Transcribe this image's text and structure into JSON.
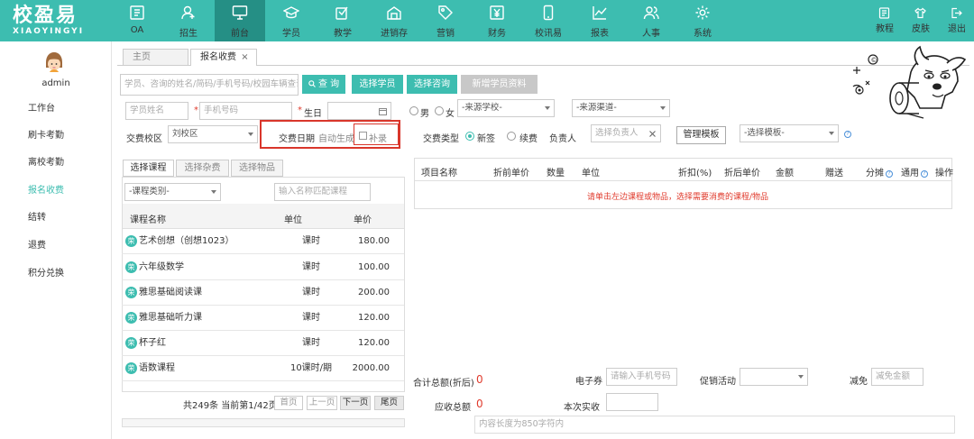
{
  "app": {
    "logo_cn": "校盈易",
    "logo_en": "XIAOYINGYI"
  },
  "nav": {
    "items": [
      {
        "label": "OA",
        "icon": "oa-icon"
      },
      {
        "label": "招生",
        "icon": "person-plus-icon"
      },
      {
        "label": "前台",
        "icon": "monitor-icon"
      },
      {
        "label": "学员",
        "icon": "graduation-cap-icon"
      },
      {
        "label": "教学",
        "icon": "book-pen-icon"
      },
      {
        "label": "进销存",
        "icon": "warehouse-icon"
      },
      {
        "label": "营销",
        "icon": "tag-icon"
      },
      {
        "label": "财务",
        "icon": "yen-icon"
      },
      {
        "label": "校讯易",
        "icon": "phone-icon"
      },
      {
        "label": "报表",
        "icon": "chart-icon"
      },
      {
        "label": "人事",
        "icon": "people-icon"
      },
      {
        "label": "系统",
        "icon": "gear-icon"
      }
    ],
    "active": "前台",
    "right": [
      {
        "label": "教程",
        "icon": "tutorial-icon"
      },
      {
        "label": "皮肤",
        "icon": "shirt-icon"
      },
      {
        "label": "退出",
        "icon": "exit-icon"
      }
    ]
  },
  "sidebar": {
    "user": "admin",
    "items": [
      {
        "label": "工作台"
      },
      {
        "label": "刷卡考勤"
      },
      {
        "label": "离校考勤"
      },
      {
        "label": "报名收费"
      },
      {
        "label": "结转"
      },
      {
        "label": "退费"
      },
      {
        "label": "积分兑换"
      }
    ],
    "active": "报名收费"
  },
  "tabs": [
    {
      "label": "主页"
    },
    {
      "label": "报名收费",
      "close": "×"
    }
  ],
  "search": {
    "placeholder": "学员、咨询的姓名/简码/手机号码/校园车辆查询",
    "search_btn": "查 询",
    "select_student": "选择学员",
    "select_consult": "选择咨询",
    "new_student": "新增学员资料"
  },
  "form": {
    "name_placeholder": "学员姓名",
    "phone_placeholder": "手机号码",
    "birthday_label": "生日",
    "gender_male": "男",
    "gender_female": "女",
    "school_select": "-来源学校-",
    "channel_select": "-来源渠道-",
    "campus_label": "交费校区",
    "campus_value": "刘校区",
    "pay_date_label": "交费日期",
    "auto_gen": "自动生成",
    "makeup": "补录",
    "pay_type_label": "交费类型",
    "pay_type_new": "新签",
    "pay_type_renew": "续费",
    "person_label": "负责人",
    "person_placeholder": "选择负责人",
    "manage_template": "管理模板",
    "template_select": "-选择模板-",
    "required_mark": "*"
  },
  "left_panel": {
    "tabs": [
      "选择课程",
      "选择杂费",
      "选择物品"
    ],
    "category_select": "-课程类别-",
    "name_filter_placeholder": "输入名称匹配课程",
    "headers": {
      "name": "课程名称",
      "unit": "单位",
      "price": "单价"
    },
    "course_icon": "荣",
    "courses": [
      {
        "name": "艺术创想（创想1023）",
        "unit": "课时",
        "price": "180.00"
      },
      {
        "name": "六年级数学",
        "unit": "课时",
        "price": "100.00"
      },
      {
        "name": "雅思基础阅读课",
        "unit": "课时",
        "price": "200.00"
      },
      {
        "name": "雅思基础听力课",
        "unit": "课时",
        "price": "120.00"
      },
      {
        "name": "杯子红",
        "unit": "课时",
        "price": "120.00"
      },
      {
        "name": "语数课程",
        "unit": "10课时/期",
        "price": "2000.00"
      }
    ],
    "pagination": {
      "summary": "共249条 当前第1/42页",
      "first": "首页",
      "prev": "上一页",
      "next": "下一页",
      "last": "尾页"
    }
  },
  "right_panel": {
    "headers": [
      "项目名称",
      "折前单价",
      "数量",
      "单位",
      "折扣(%)",
      "折后单价",
      "金额",
      "赠送",
      "分摊",
      "通用",
      "操作"
    ],
    "empty_hint": "请单击左边课程或物品，选择需要消费的课程/物品",
    "total_label": "合计总额(折后)",
    "total_value": "0",
    "receivable_label": "应收总额",
    "receivable_value": "0",
    "coupon_label": "电子券",
    "coupon_placeholder": "请输入手机号码",
    "promo_label": "促销活动",
    "discount_label": "减免",
    "discount_placeholder": "减免金额",
    "paid_label": "本次实收",
    "remark_placeholder": "内容长度为850字符内"
  },
  "colors": {
    "brand": "#3dbdb0",
    "brand_dark": "#258f85",
    "alert": "#e03b2d",
    "highlight_box": "#d9362b"
  }
}
